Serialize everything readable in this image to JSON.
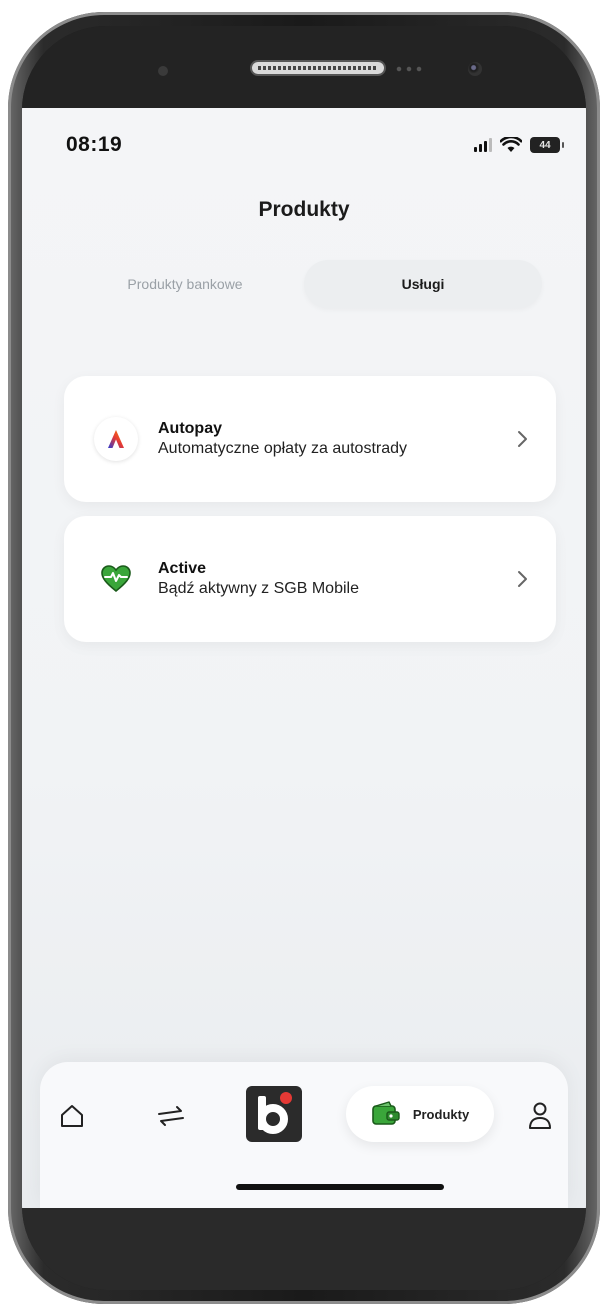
{
  "status_bar": {
    "time": "08:19",
    "battery": "44"
  },
  "header": {
    "title": "Produkty"
  },
  "tabs": [
    {
      "label": "Produkty bankowe",
      "active": false
    },
    {
      "label": "Usługi",
      "active": true
    }
  ],
  "services": [
    {
      "title": "Autopay",
      "subtitle": "Automatyczne opłaty za autostrady",
      "icon": "autopay-icon"
    },
    {
      "title": "Active",
      "subtitle": "Bądź aktywny z SGB Mobile",
      "icon": "heart-pulse-icon"
    }
  ],
  "nav": {
    "items": [
      {
        "icon": "home-icon"
      },
      {
        "icon": "transfer-icon"
      },
      {
        "icon": "brand-logo-icon"
      },
      {
        "icon": "wallet-icon",
        "label": "Produkty",
        "active": true
      },
      {
        "icon": "profile-icon"
      }
    ]
  },
  "colors": {
    "accent_green": "#3aa63a",
    "brand_dark": "#2b2b2b",
    "brand_red": "#e53935"
  }
}
